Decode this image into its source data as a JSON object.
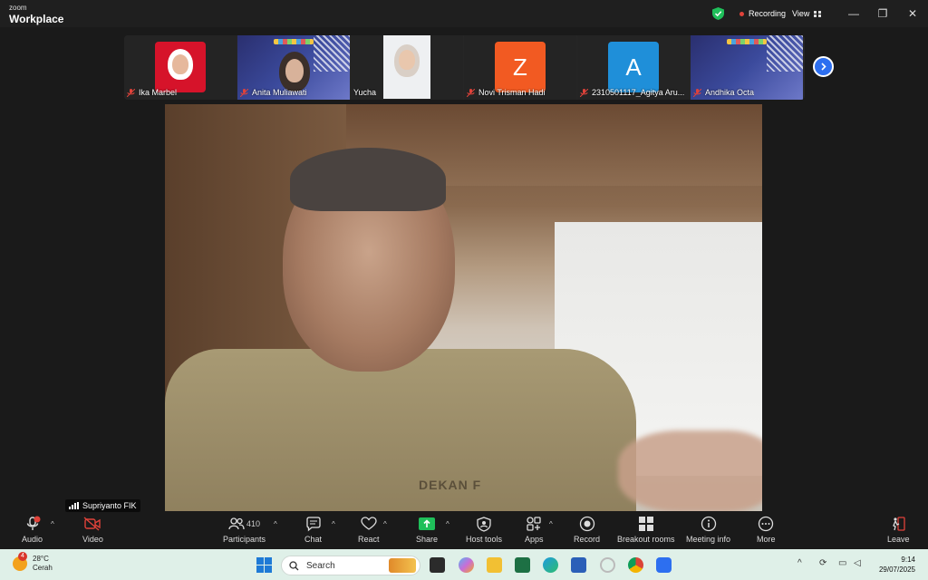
{
  "app": {
    "brand_small": "zoom",
    "brand_big": "Workplace"
  },
  "titlebar": {
    "recording_label": "Recording",
    "view_label": "View",
    "minimize": "—",
    "restore": "❐",
    "close": "✕"
  },
  "participants_strip": [
    {
      "name": "Ika Marbel",
      "muted": true,
      "kind": "photo",
      "bg": "#d6132a"
    },
    {
      "name": "Anita Muliawati",
      "muted": true,
      "kind": "slide"
    },
    {
      "name": "Yucha",
      "muted": false,
      "kind": "photo",
      "bg": "#f0f0f0"
    },
    {
      "name": "Novi Trisman Hadi",
      "muted": true,
      "kind": "letter",
      "letter": "Z",
      "bg": "#f25a22"
    },
    {
      "name": "2310501117_Agitya Aru...",
      "muted": true,
      "kind": "letter",
      "letter": "A",
      "bg": "#1f8fd9"
    },
    {
      "name": "Andhika Octa",
      "muted": true,
      "kind": "slide"
    }
  ],
  "main_video": {
    "speaker_name": "Supriyanto FIK",
    "badge_text": "DEKAN F"
  },
  "toolbar": {
    "audio": "Audio",
    "video": "Video",
    "participants": "Participants",
    "participants_count": "410",
    "chat": "Chat",
    "react": "React",
    "share": "Share",
    "host_tools": "Host tools",
    "apps": "Apps",
    "record": "Record",
    "breakout_rooms": "Breakout rooms",
    "meeting_info": "Meeting info",
    "more": "More",
    "leave": "Leave"
  },
  "taskbar": {
    "weather_temp": "28°C",
    "weather_desc": "Cerah",
    "weather_badge": "4",
    "search_placeholder": "Search",
    "time": "9:14",
    "date": "29/07/2025"
  },
  "colors": {
    "accent_blue": "#2d6ff0",
    "record_red": "#e0423a",
    "share_green": "#1fbf5a",
    "leave_red": "#e0423a"
  }
}
